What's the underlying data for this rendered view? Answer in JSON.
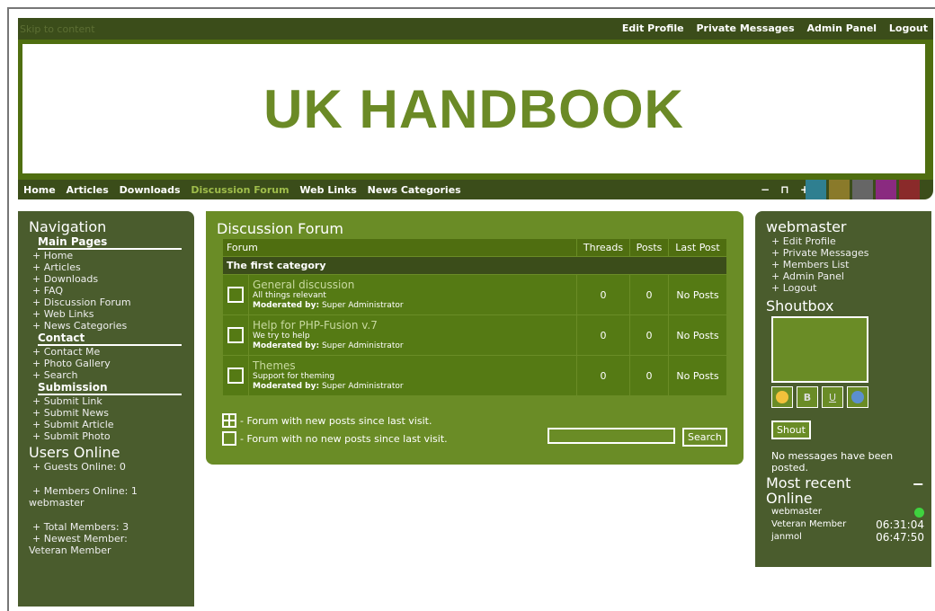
{
  "header": {
    "skip": "Skip to content",
    "user_links": [
      "Edit Profile",
      "Private Messages",
      "Admin Panel",
      "Logout"
    ],
    "title": "UK HANDBOOK"
  },
  "nav": {
    "links": [
      "Home",
      "Articles",
      "Downloads",
      "Discussion Forum",
      "Web Links",
      "News Categories"
    ],
    "active_index": 3,
    "tools": [
      "−",
      "⊓",
      "+"
    ],
    "swatches": [
      "#2f7f90",
      "#8a7a2a",
      "#666666",
      "#8a2a80",
      "#8a2a2a"
    ]
  },
  "left": {
    "title": "Navigation",
    "sections": [
      {
        "title": "Main Pages",
        "items": [
          "+ Home",
          "+ Articles",
          "+ Downloads",
          "+ FAQ",
          "+ Discussion Forum",
          "+ Web Links",
          "+ News Categories"
        ]
      },
      {
        "title": "Contact",
        "items": [
          "+ Contact Me",
          "+ Photo Gallery",
          "+ Search"
        ]
      },
      {
        "title": "Submission",
        "items": [
          "+ Submit Link",
          "+ Submit News",
          "+ Submit Article",
          "+ Submit Photo"
        ]
      }
    ],
    "users_title": "Users Online",
    "guests": "+ Guests Online: 0",
    "members": "+ Members Online: 1",
    "members_name": "webmaster",
    "total": "+ Total Members: 3",
    "newest": "+ Newest Member:",
    "newest_name": "Veteran Member"
  },
  "center": {
    "title": "Discussion Forum",
    "columns": [
      "Forum",
      "Threads",
      "Posts",
      "Last Post"
    ],
    "category": "The first category",
    "forums": [
      {
        "title": "General discussion",
        "desc": "All things relevant",
        "mod_label": "Moderated by:",
        "mod": "Super Administrator",
        "threads": "0",
        "posts": "0",
        "last": "No Posts"
      },
      {
        "title": "Help for PHP-Fusion v.7",
        "desc": "We try to help",
        "mod_label": "Moderated by:",
        "mod": "Super Administrator",
        "threads": "0",
        "posts": "0",
        "last": "No Posts"
      },
      {
        "title": "Themes",
        "desc": "Support for theming",
        "mod_label": "Moderated by:",
        "mod": "Super Administrator",
        "threads": "0",
        "posts": "0",
        "last": "No Posts"
      }
    ],
    "legend_new": "- Forum with new posts since last visit.",
    "legend_none": "- Forum with no new posts since last visit.",
    "search_button": "Search"
  },
  "right": {
    "user": "webmaster",
    "links": [
      "+ Edit Profile",
      "+ Private Messages",
      "+ Members List",
      "+ Admin Panel",
      "+ Logout"
    ],
    "shoutbox_title": "Shoutbox",
    "shout_button": "Shout",
    "no_messages": "No messages have been posted.",
    "recent_title": "Most recent Online",
    "collapse": "−",
    "recent": [
      {
        "name": "webmaster",
        "time": ""
      },
      {
        "name": "Veteran Member",
        "time": "06:31:04"
      },
      {
        "name": "janmol",
        "time": "06:47:50"
      }
    ]
  }
}
